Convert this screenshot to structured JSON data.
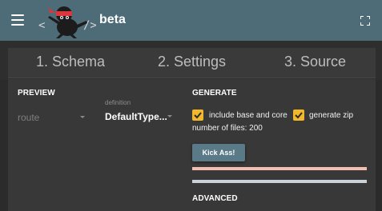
{
  "app": {
    "title": "beta"
  },
  "tabs": [
    {
      "label": "1. Schema"
    },
    {
      "label": "2. Settings"
    },
    {
      "label": "3. Source"
    }
  ],
  "preview": {
    "heading": "PREVIEW",
    "route_select": {
      "value": "route"
    },
    "definition_select": {
      "label": "definition",
      "value": "DefaultType..."
    }
  },
  "generate": {
    "heading": "GENERATE",
    "include_base_core": {
      "label": "include base and core",
      "checked": true
    },
    "generate_zip": {
      "label": "generate zip",
      "checked": true
    },
    "file_count_text": "number of files: 200",
    "kick_button": "Kick Ass!"
  },
  "advanced": {
    "heading": "ADVANCED"
  },
  "colors": {
    "appbar": "#4e6b78",
    "accent_checkbox": "#f0b82a",
    "progress_1": "#f2bfb0",
    "progress_2": "#c9d3d8"
  }
}
